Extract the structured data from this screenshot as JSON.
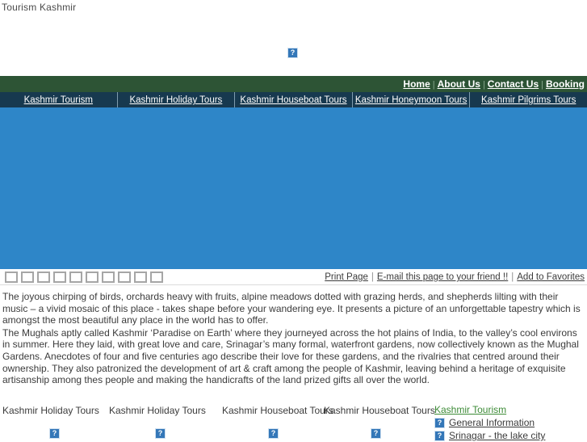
{
  "page": {
    "title": "Tourism Kashmir"
  },
  "logo": {
    "icon": "broken-image-icon"
  },
  "topbar": {
    "separator": "|",
    "links": [
      {
        "label": "Home"
      },
      {
        "label": "About Us"
      },
      {
        "label": "Contact Us"
      },
      {
        "label": "Booking"
      }
    ]
  },
  "mainnav": {
    "items": [
      {
        "label": "Kashmir Tourism"
      },
      {
        "label": "Kashmir Holiday Tours"
      },
      {
        "label": "Kashmir Houseboat Tours"
      },
      {
        "label": "Kashmir Honeymoon Tours"
      },
      {
        "label": "Kashmir Pilgrims Tours"
      }
    ]
  },
  "hero": {
    "background_color": "#2e86c8"
  },
  "thumbstrip": {
    "count": 10
  },
  "utils": {
    "separator": "|",
    "links": [
      {
        "label": "Print Page"
      },
      {
        "label": "E-mail this page to your friend !!"
      },
      {
        "label": "Add to Favorites"
      }
    ]
  },
  "copy": {
    "paragraphs": [
      "The joyous chirping of birds, orchards heavy with fruits, alpine meadows dotted with grazing herds, and shepherds lilting with their music – a vivid mosaic of this place - takes shape before your wandering eye. It presents a picture of an unforgettable tapestry which is amongst the most beautiful any place in the world has to offer.",
      "The Mughals aptly called Kashmir ‘Paradise on Earth’ where they journeyed across the hot plains of India, to the valley’s cool environs in summer. Here they laid, with great love and care, Srinagar’s many formal, waterfront gardens, now collectively known as the Mughal Gardens. Anecdotes of four and five centuries ago describe their love for these gardens, and the rivalries that centred around their ownership. They also patronized the development of art & craft among the people of Kashmir, leaving behind a heritage of exquisite artisanship among thes people and making the handicrafts of the land prized gifts all over the world."
    ]
  },
  "bottom": {
    "columns": [
      {
        "title": "Kashmir Holiday Tours",
        "icon": "broken-image-icon"
      },
      {
        "title": "Kashmir Holiday Tours",
        "icon": "broken-image-icon"
      },
      {
        "title": "Kashmir Houseboat Tours",
        "icon": "broken-image-icon"
      },
      {
        "title": "Kashmir Houseboat Tours",
        "icon": "broken-image-icon"
      }
    ],
    "linkcolumn": {
      "heading": "Kashmir Tourism",
      "links": [
        {
          "label": "General Information",
          "icon": "broken-image-icon"
        },
        {
          "label": "Srinagar - the lake city",
          "icon": "broken-image-icon"
        }
      ]
    }
  },
  "colors": {
    "topbar_green": "#2d5435",
    "nav_navy": "#17394f",
    "hero_blue": "#2e86c8",
    "heading_green": "#3d8b37"
  }
}
